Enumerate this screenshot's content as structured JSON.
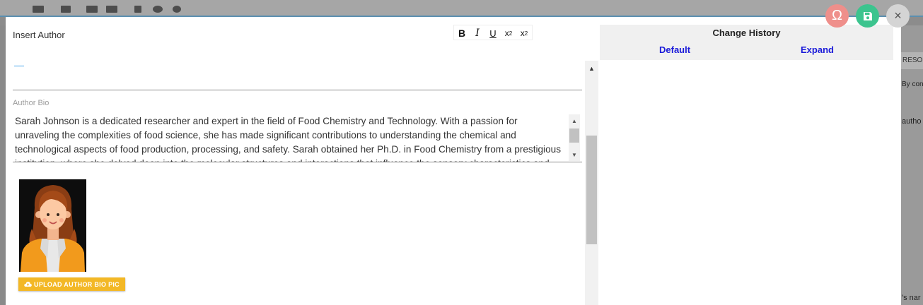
{
  "background": {
    "right_header_text": "RESO",
    "right_texts": [
      "By con",
      "autho",
      "'s nar"
    ]
  },
  "editor": {
    "insert_author_label": "Insert Author",
    "author_value": "",
    "cursor_mark": "—",
    "bio_label": "Author Bio",
    "bio_text": "Sarah Johnson is a dedicated researcher and expert in the field of Food Chemistry and Technology. With a passion for unraveling the complexities of food science, she has made significant contributions to understanding the chemical and technological aspects of food production, processing, and safety. Sarah obtained her Ph.D. in Food Chemistry from a prestigious institution, where she delved deep into the molecular structures and interactions that influence the sensory characteristics and nutritional properties of food.",
    "upload_button_label": "UPLOAD AUTHOR BIO PIC"
  },
  "format_toolbar": {
    "bold": "B",
    "italic": "I",
    "underline": "U",
    "superscript": "x",
    "subscript": "x"
  },
  "history": {
    "title": "Change History",
    "default_label": "Default",
    "expand_label": "Expand"
  },
  "actions": {
    "special_char_glyph": "Ω",
    "close_glyph": "×"
  },
  "colors": {
    "link_blue": "#1a1ad9",
    "upload_yellow": "#f3b826",
    "special_char_red": "#ef8f8b",
    "save_green": "#3cc48e"
  },
  "icons": {
    "special_char": "omega-icon",
    "save": "floppy-disk-icon",
    "close": "close-icon",
    "upload": "cloud-upload-icon"
  }
}
